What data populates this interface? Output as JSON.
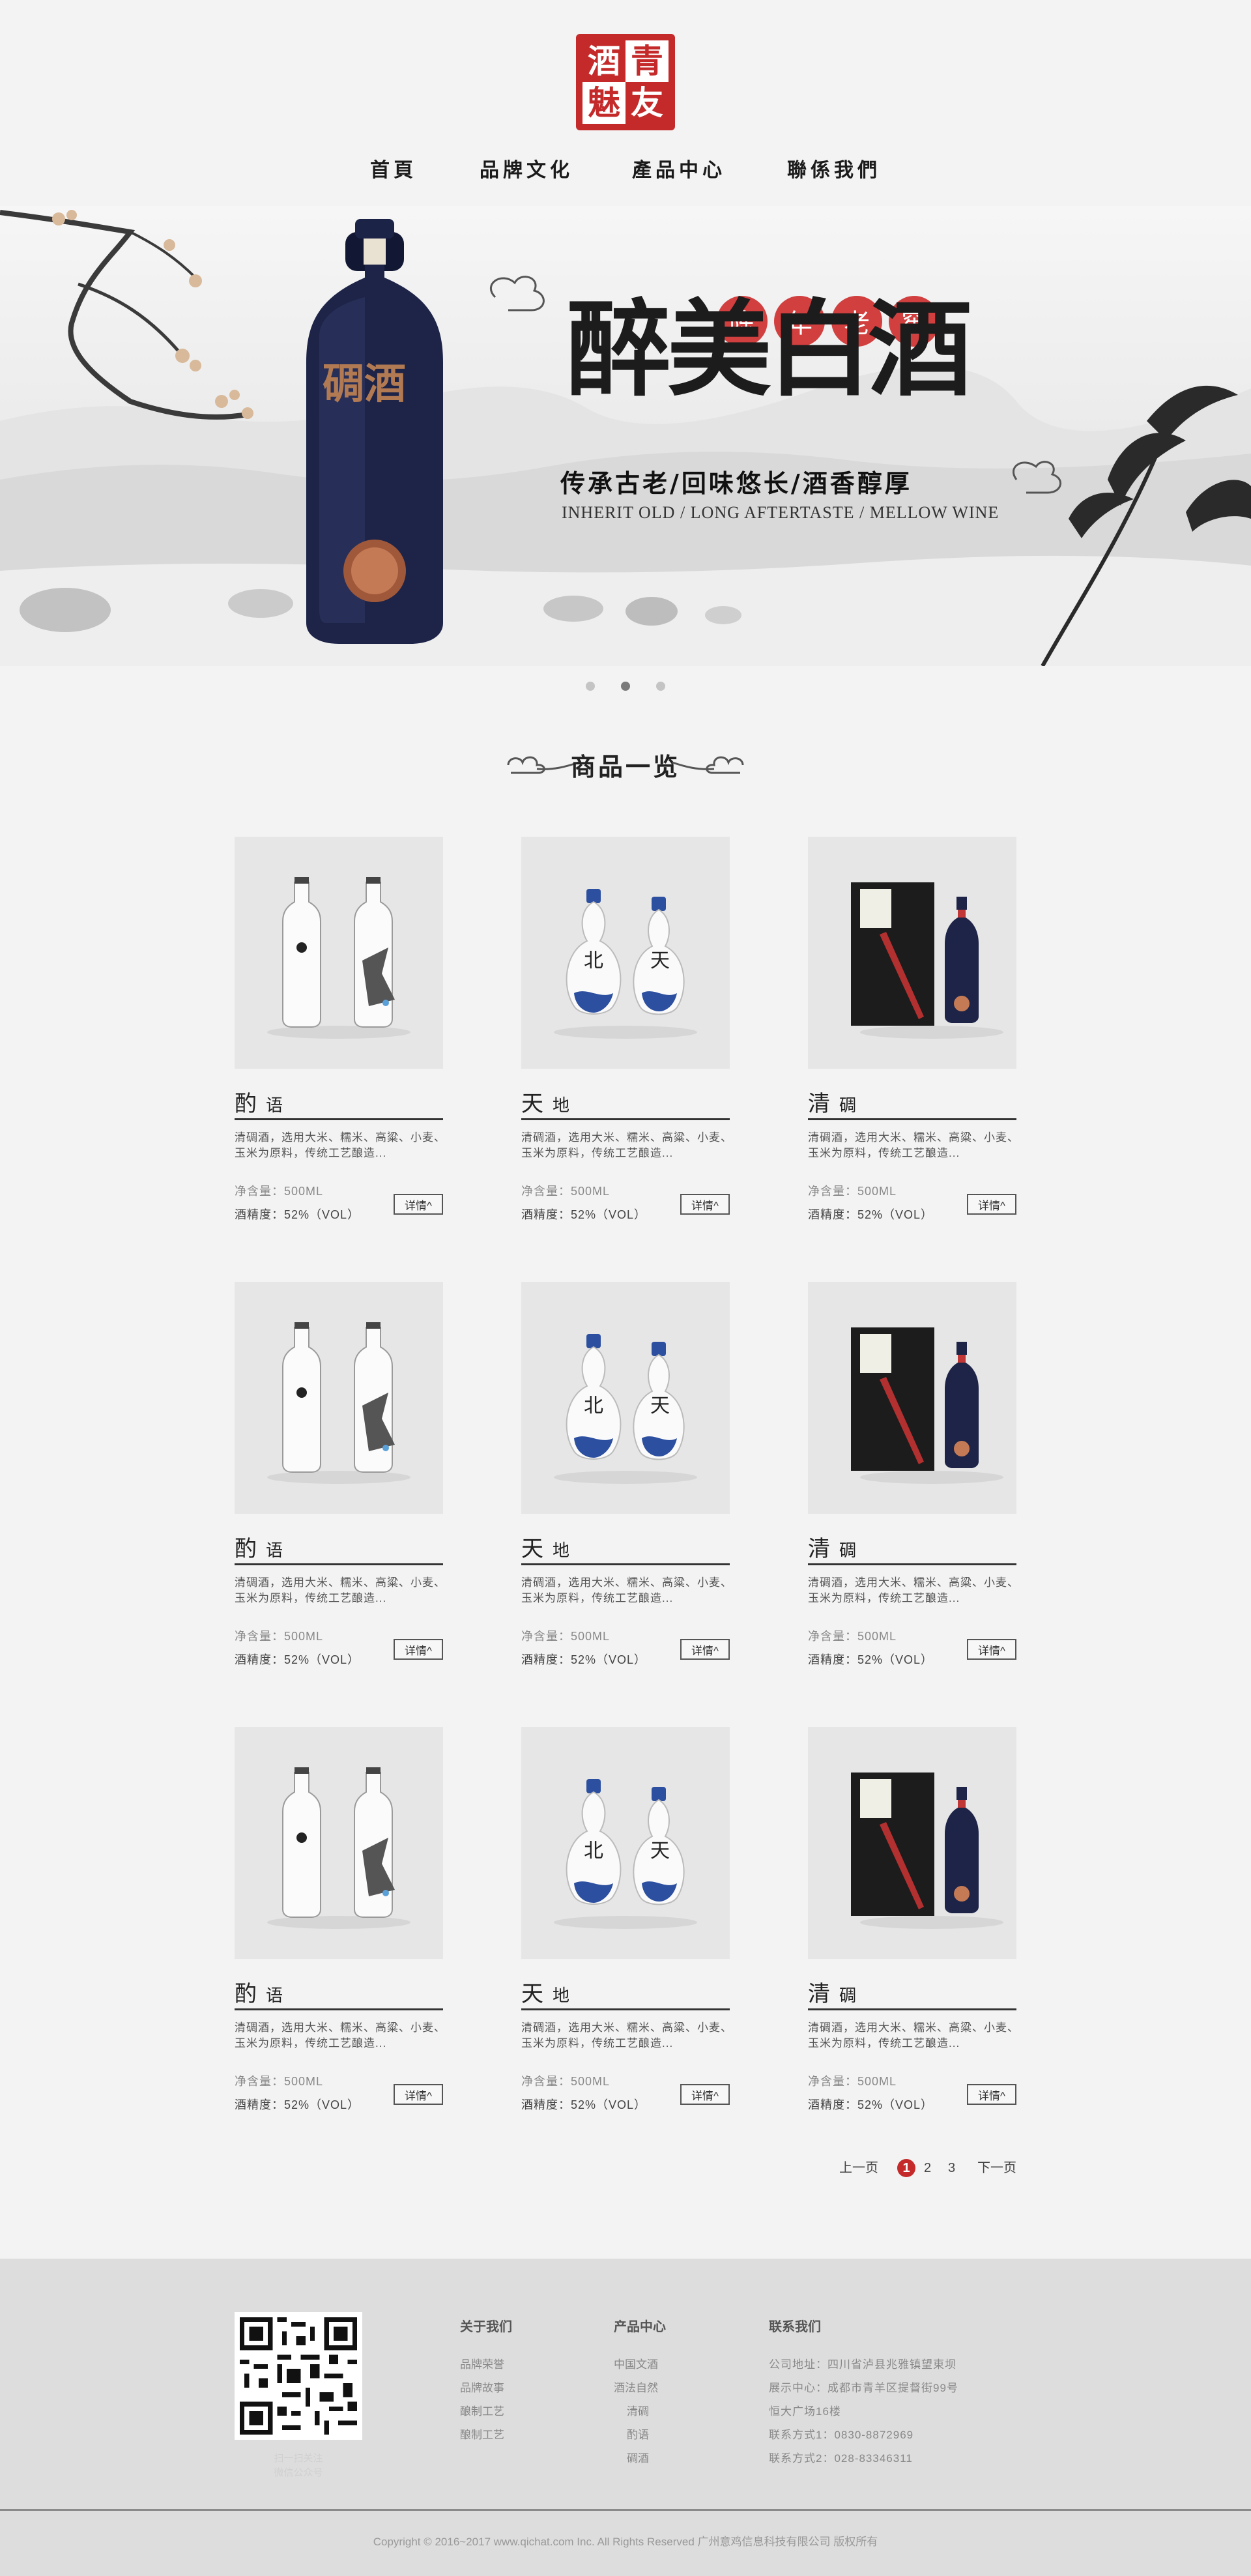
{
  "logo": {
    "chars": [
      "酒",
      "青",
      "魅",
      "友"
    ]
  },
  "nav": [
    {
      "label": "首頁"
    },
    {
      "label": "品牌文化"
    },
    {
      "label": "產品中心"
    },
    {
      "label": "聯係我們"
    }
  ],
  "banner": {
    "badges": [
      "陈",
      "年",
      "老",
      "窖"
    ],
    "title": "醉美白酒",
    "tagline": "传承古老/回味悠长/酒香醇厚",
    "subtitle": "INHERIT OLD / LONG AFTERTASTE / MELLOW WINE",
    "bottle_label": "碉酒",
    "slides": 3,
    "active_slide": 2
  },
  "section": {
    "title": "商品一览"
  },
  "products": [
    {
      "name": "酌",
      "name2": "语",
      "desc": "清碉酒，选用大米、糯米、高粱、小麦、玉米为原料，传统工艺酿造...",
      "spec1": "净含量：500ML",
      "spec2": "酒精度：52%（VOL）",
      "btn": "详情^",
      "art": "clear"
    },
    {
      "name": "天",
      "name2": "地",
      "desc": "清碉酒，选用大米、糯米、高粱、小麦、玉米为原料，传统工艺酿造...",
      "spec1": "净含量：500ML",
      "spec2": "酒精度：52%（VOL）",
      "btn": "详情^",
      "art": "porcelain"
    },
    {
      "name": "清",
      "name2": "碉",
      "desc": "清碉酒，选用大米、糯米、高粱、小麦、玉米为原料，传统工艺酿造...",
      "spec1": "净含量：500ML",
      "spec2": "酒精度：52%（VOL）",
      "btn": "详情^",
      "art": "box"
    },
    {
      "name": "酌",
      "name2": "语",
      "desc": "清碉酒，选用大米、糯米、高粱、小麦、玉米为原料，传统工艺酿造...",
      "spec1": "净含量：500ML",
      "spec2": "酒精度：52%（VOL）",
      "btn": "详情^",
      "art": "clear"
    },
    {
      "name": "天",
      "name2": "地",
      "desc": "清碉酒，选用大米、糯米、高粱、小麦、玉米为原料，传统工艺酿造...",
      "spec1": "净含量：500ML",
      "spec2": "酒精度：52%（VOL）",
      "btn": "详情^",
      "art": "porcelain"
    },
    {
      "name": "清",
      "name2": "碉",
      "desc": "清碉酒，选用大米、糯米、高粱、小麦、玉米为原料，传统工艺酿造...",
      "spec1": "净含量：500ML",
      "spec2": "酒精度：52%（VOL）",
      "btn": "详情^",
      "art": "box"
    },
    {
      "name": "酌",
      "name2": "语",
      "desc": "清碉酒，选用大米、糯米、高粱、小麦、玉米为原料，传统工艺酿造...",
      "spec1": "净含量：500ML",
      "spec2": "酒精度：52%（VOL）",
      "btn": "详情^",
      "art": "clear"
    },
    {
      "name": "天",
      "name2": "地",
      "desc": "清碉酒，选用大米、糯米、高粱、小麦、玉米为原料，传统工艺酿造...",
      "spec1": "净含量：500ML",
      "spec2": "酒精度：52%（VOL）",
      "btn": "详情^",
      "art": "porcelain"
    },
    {
      "name": "清",
      "name2": "碉",
      "desc": "清碉酒，选用大米、糯米、高粱、小麦、玉米为原料，传统工艺酿造...",
      "spec1": "净含量：500ML",
      "spec2": "酒精度：52%（VOL）",
      "btn": "详情^",
      "art": "box"
    }
  ],
  "pagination": {
    "prev": "上一页",
    "pages": [
      "1",
      "2",
      "3"
    ],
    "current": "1",
    "next": "下一页"
  },
  "footer": {
    "qr_caption": [
      "扫一扫关注",
      "微信公众号"
    ],
    "about": {
      "title": "关于我们",
      "items": [
        "品牌荣誉",
        "品牌故事",
        "酿制工艺",
        "酿制工艺"
      ]
    },
    "products": {
      "title": "产品中心",
      "items": [
        "中国文酒",
        "酒法自然",
        "清碉",
        "酌语",
        "碉酒"
      ]
    },
    "contact": {
      "title": "联系我们",
      "lines": [
        "公司地址：四川省泸县兆雅镇望東坝",
        "展示中心：成都市青羊区提督街99号",
        "恒大广场16楼",
        "联系方式1：0830-8872969",
        "联系方式2：028-83346311"
      ]
    },
    "copyright": "Copyright © 2016~2017 www.qichat.com Inc. All Rights Reserved 广州意鸡信息科技有限公司 版权所有"
  },
  "colors": {
    "accent": "#c42a2a",
    "footer_bg": "#dddddd",
    "page_bg": "#f3f3f3"
  }
}
